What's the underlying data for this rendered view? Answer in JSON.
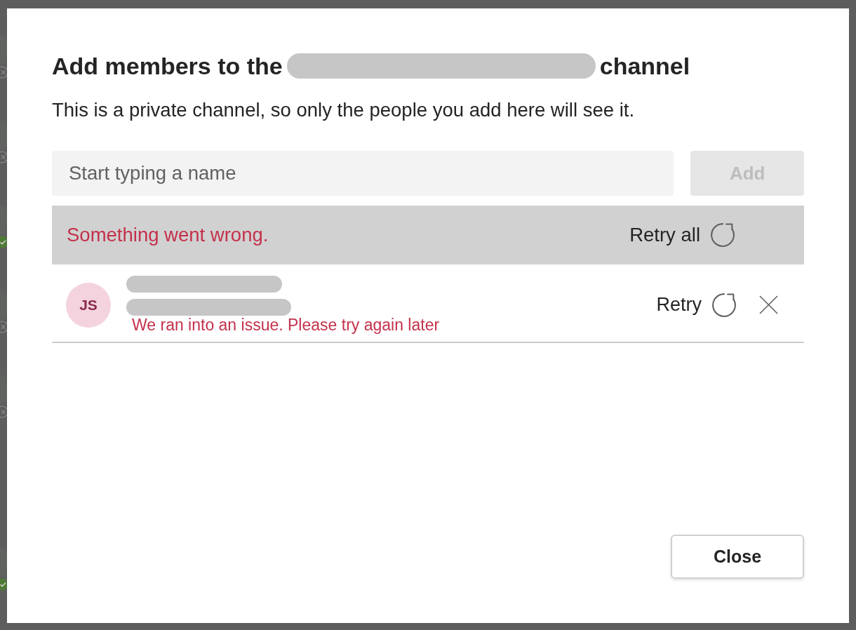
{
  "background": {
    "contacts": [
      {
        "kind": "offline"
      },
      {
        "kind": "offline"
      },
      {
        "kind": "available"
      },
      {
        "kind": "offline"
      },
      {
        "kind": "offline"
      },
      {
        "kind": "available"
      }
    ]
  },
  "dialog": {
    "title_start": "Add members to the",
    "title_end": "channel",
    "subtitle": "This is a private channel, so only the people you add here will see it.",
    "search": {
      "placeholder": "Start typing a name"
    },
    "add_button": {
      "label": "Add",
      "disabled": true
    },
    "error_banner": {
      "message": "Something went wrong.",
      "retry_all": "Retry all"
    },
    "members": [
      {
        "initials": "JS",
        "error": "We ran into an issue. Please try again later",
        "retry": "Retry"
      }
    ],
    "close_button": "Close"
  }
}
